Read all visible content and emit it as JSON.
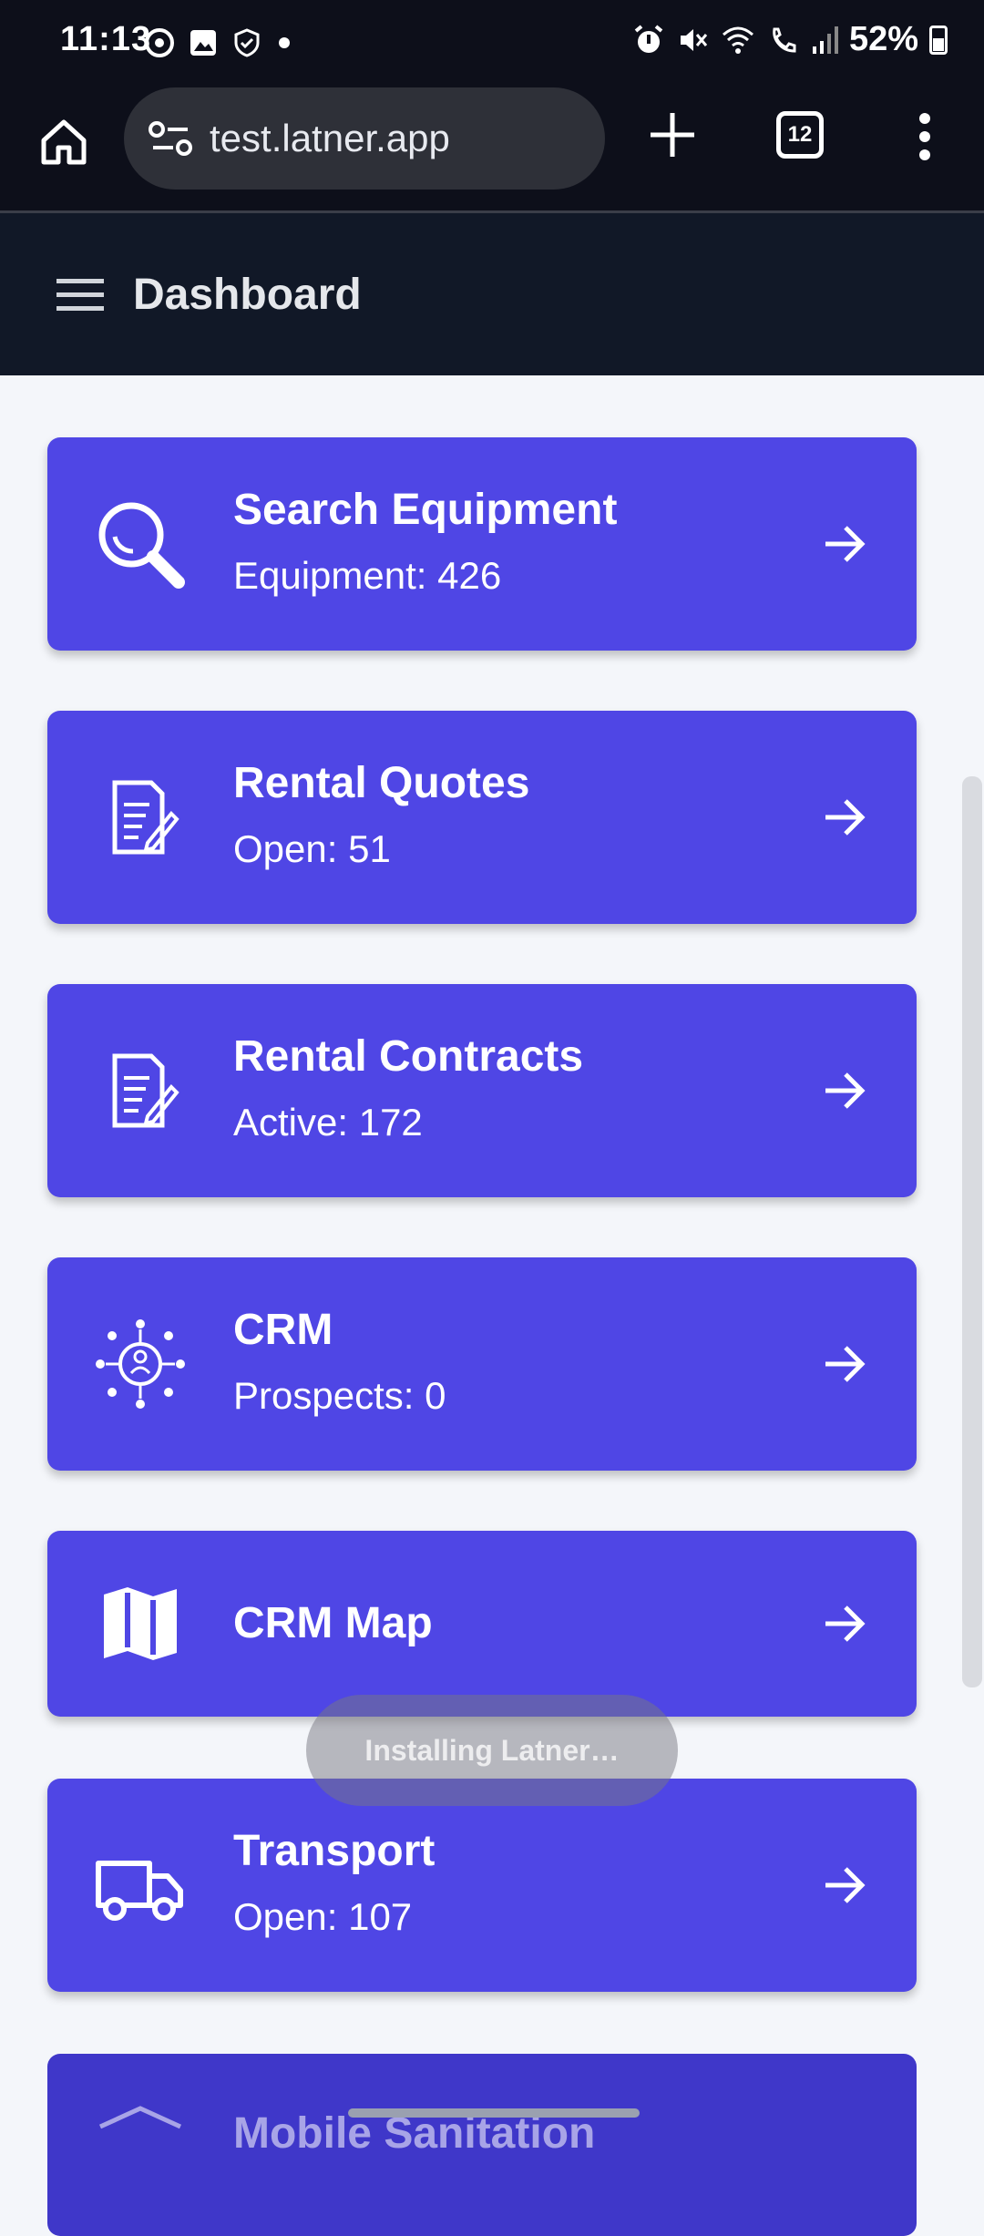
{
  "status_bar": {
    "time": "11:13",
    "battery": "52%"
  },
  "browser": {
    "url": "test.latner.app",
    "tab_count": "12"
  },
  "app_bar": {
    "title": "Dashboard"
  },
  "cards": [
    {
      "title": "Search Equipment",
      "subtitle": "Equipment: 426",
      "icon": "search-icon"
    },
    {
      "title": "Rental Quotes",
      "subtitle": "Open: 51",
      "icon": "document-edit-icon"
    },
    {
      "title": "Rental Contracts",
      "subtitle": "Active: 172",
      "icon": "document-edit-icon"
    },
    {
      "title": "CRM",
      "subtitle": "Prospects: 0",
      "icon": "crm-network-icon"
    },
    {
      "title": "CRM Map",
      "subtitle": "",
      "icon": "map-icon"
    },
    {
      "title": "Transport",
      "subtitle": "Open: 107",
      "icon": "truck-icon"
    },
    {
      "title": "Mobile Sanitation",
      "subtitle": "",
      "icon": "sanitation-icon"
    }
  ],
  "toast": {
    "text": "Installing Latner…"
  },
  "colors": {
    "card": "#4f46e5",
    "app_bar": "#111827",
    "status_bar": "#0d0f1a"
  }
}
